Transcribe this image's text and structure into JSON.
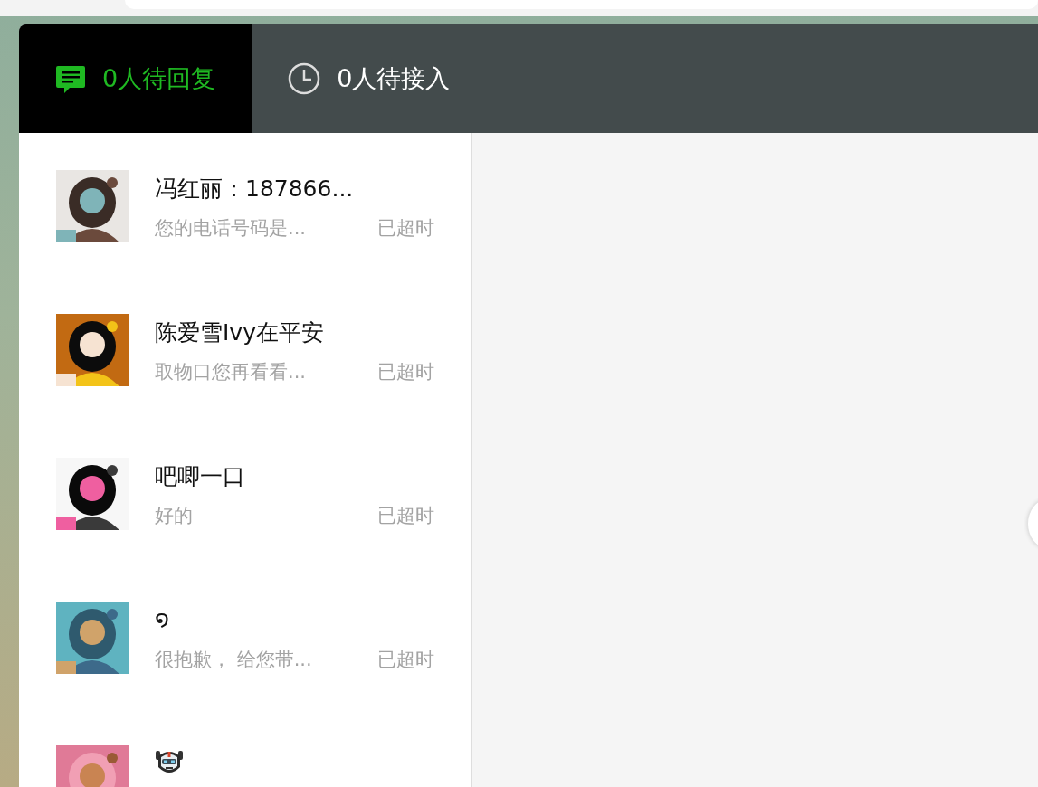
{
  "tabs": [
    {
      "kind": "chat",
      "label": "0人待回复",
      "selected": true
    },
    {
      "kind": "clock",
      "label": "0人待接入",
      "selected": false
    }
  ],
  "conversations": [
    {
      "kind": "text",
      "name": "冯红丽：187866...",
      "preview": "您的电话号码是...",
      "status": "已超时"
    },
    {
      "kind": "text",
      "name": "陈爱雪Ivy在平安",
      "preview": "取物口您再看看...",
      "status": "已超时"
    },
    {
      "kind": "text",
      "name": "吧唧一口",
      "preview": "好的",
      "status": "已超时"
    },
    {
      "kind": "text",
      "name": "໑",
      "preview": "很抱歉， 给您带...",
      "status": "已超时"
    },
    {
      "kind": "robot-icon"
    }
  ]
}
